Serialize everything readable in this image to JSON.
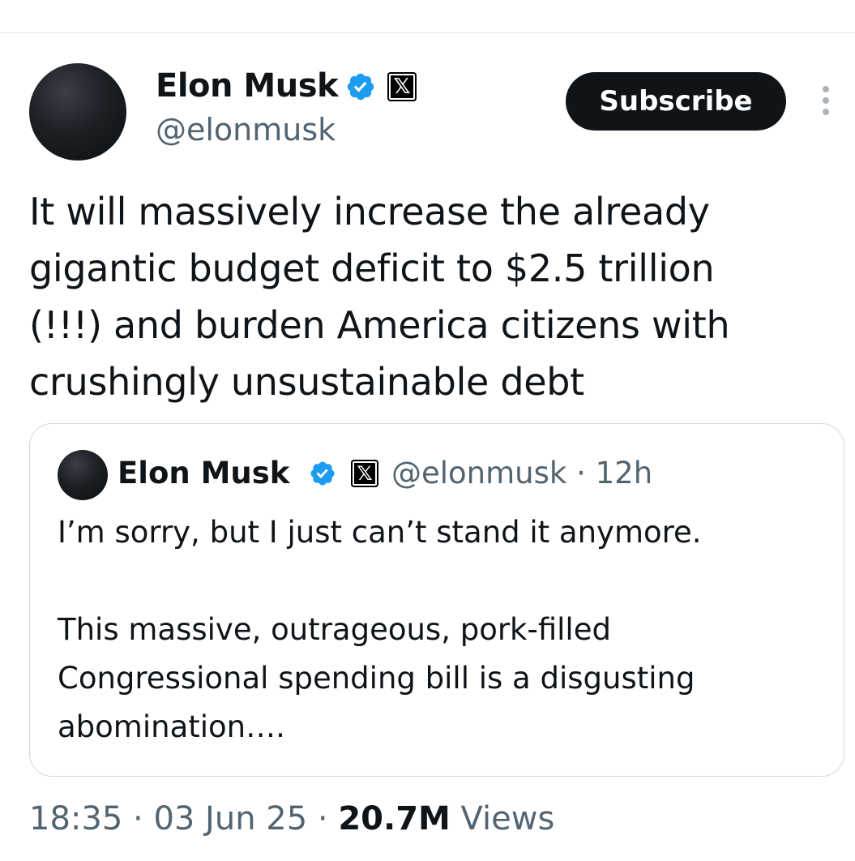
{
  "author": {
    "name": "Elon Musk",
    "handle": "@elonmusk",
    "verified_icon": "verified-badge-icon",
    "affiliate_icon": "x-logo-icon"
  },
  "actions": {
    "subscribe_label": "Subscribe",
    "more_icon": "more-vertical-icon"
  },
  "tweet": {
    "text": "It will massively increase the already\ngigantic budget deficit to $2.5 trillion\n(!!!) and burden America citizens with\ncrushingly unsustainable debt"
  },
  "quote": {
    "name": "Elon Musk",
    "handle": "@elonmusk",
    "separator": " · ",
    "time": "12h",
    "text": "I’m sorry, but I just can’t stand it anymore.\n\nThis massive, outrageous, pork-filled\nCongressional spending bill is a disgusting\nabomination…."
  },
  "footer": {
    "time": "18:35",
    "sep1": " · ",
    "date": "03 Jun 25",
    "sep2": " · ",
    "views_count": "20.7M",
    "views_label": " Views"
  },
  "colors": {
    "verified": "#1d9bf0",
    "text": "#0f1419",
    "secondary": "#536471",
    "border": "#cfd9de"
  }
}
